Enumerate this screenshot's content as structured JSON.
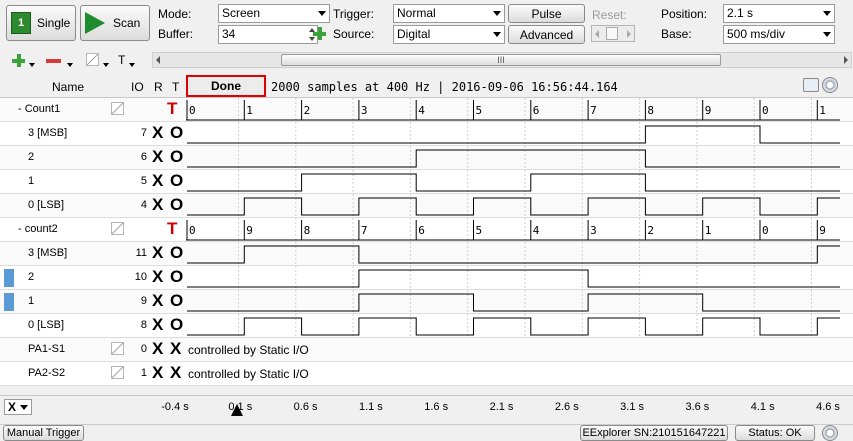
{
  "toolbar": {
    "single_label": "Single",
    "scan_label": "Scan",
    "mode_label": "Mode:",
    "mode_value": "Screen",
    "buffer_label": "Buffer:",
    "buffer_value": "34",
    "trigger_label": "Trigger:",
    "trigger_value": "Normal",
    "source_label": "Source:",
    "source_value": "Digital",
    "pulse_label": "Pulse",
    "advanced_label": "Advanced",
    "reset_label": "Reset:",
    "position_label": "Position:",
    "position_value": "2.1 s",
    "base_label": "Base:",
    "base_value": "500 ms/div",
    "single_badge": "1"
  },
  "secondary_toolbar": {
    "t_label": "T",
    "scroll_grip": "III"
  },
  "columns": {
    "name": "Name",
    "io": "IO",
    "r": "R",
    "t": "T"
  },
  "status": {
    "done": "Done",
    "info": "2000 samples at 400 Hz | 2016-09-06 16:56:44.164"
  },
  "buses": [
    {
      "name": "- Count1",
      "trigger": "T",
      "labels": [
        "0",
        "1",
        "2",
        "3",
        "4",
        "5",
        "6",
        "7",
        "8",
        "9",
        "0",
        "1"
      ]
    },
    {
      "name": "- count2",
      "trigger": "T",
      "labels": [
        "0",
        "9",
        "8",
        "7",
        "6",
        "5",
        "4",
        "3",
        "2",
        "1",
        "0",
        "9"
      ]
    }
  ],
  "channels": [
    {
      "name": "3 [MSB]",
      "io": "7",
      "r": "X",
      "t": "O"
    },
    {
      "name": "2",
      "io": "6",
      "r": "X",
      "t": "O"
    },
    {
      "name": "1",
      "io": "5",
      "r": "X",
      "t": "O"
    },
    {
      "name": "0 [LSB]",
      "io": "4",
      "r": "X",
      "t": "O"
    },
    {
      "name": "3 [MSB]",
      "io": "11",
      "r": "X",
      "t": "O"
    },
    {
      "name": "2",
      "io": "10",
      "r": "X",
      "t": "O"
    },
    {
      "name": "1",
      "io": "9",
      "r": "X",
      "t": "O"
    },
    {
      "name": "0 [LSB]",
      "io": "8",
      "r": "X",
      "t": "O"
    },
    {
      "name": "PA1-S1",
      "io": "0",
      "r": "X",
      "t": "X"
    },
    {
      "name": "PA2-S2",
      "io": "1",
      "r": "X",
      "t": "X"
    }
  ],
  "static_io_text": "controlled by Static I/O",
  "time_axis": {
    "zoom_value": "X",
    "ticks": [
      "-0.4 s",
      "0.1 s",
      "0.6 s",
      "1.1 s",
      "1.6 s",
      "2.1 s",
      "2.6 s",
      "3.1 s",
      "3.6 s",
      "4.1 s",
      "4.6 s"
    ]
  },
  "footer": {
    "manual_trigger": "Manual Trigger",
    "device": "EExplorer SN:210151647221",
    "status": "Status: OK"
  },
  "colors": {
    "accent": "#d00000",
    "done_border": "#e00000"
  }
}
